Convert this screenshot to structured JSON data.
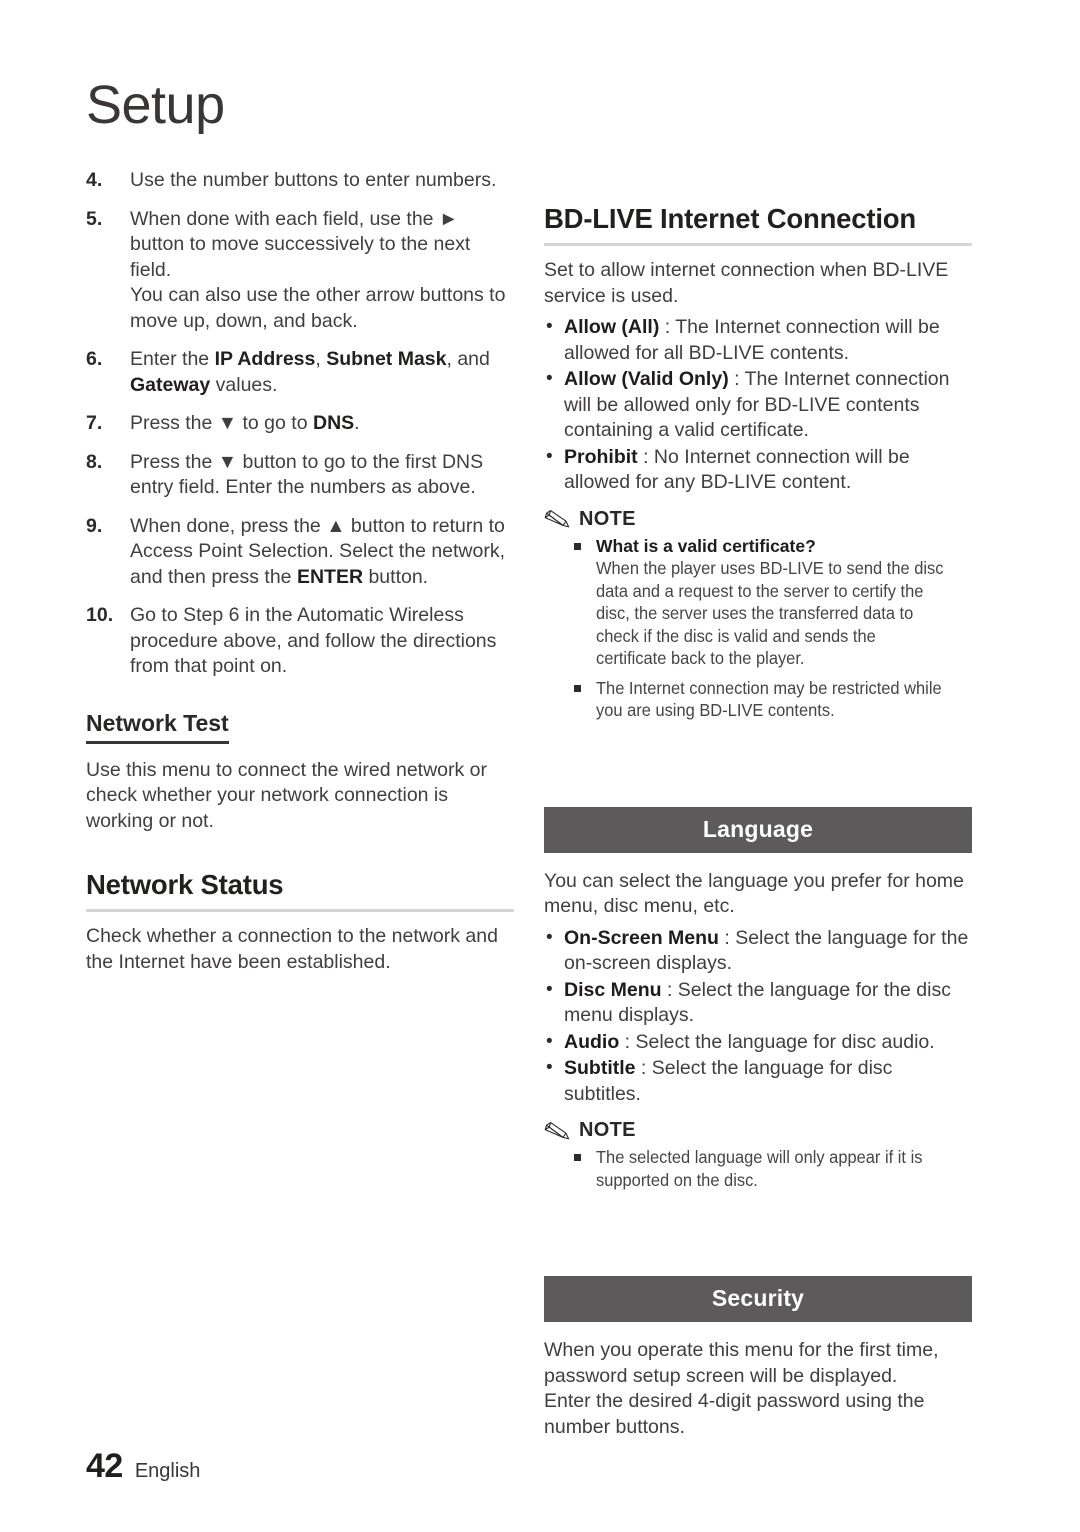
{
  "page": {
    "chapter_title": "Setup",
    "page_number": "42",
    "language": "English",
    "banner_color": "#5c5a5a",
    "text_color": "#433e3e"
  },
  "left_column": {
    "steps": [
      {
        "num": "4.",
        "html": "Use the number buttons to enter numbers."
      },
      {
        "num": "5.",
        "html": "When done with each field, use the ► button to move successively to the next field.<br>You can also use the other arrow buttons to move up, down, and back."
      },
      {
        "num": "6.",
        "html": "Enter the <b>IP Address</b>, <b>Subnet Mask</b>, and <b>Gateway</b> values."
      },
      {
        "num": "7.",
        "html": "Press the ▼ to go to <b>DNS</b>."
      },
      {
        "num": "8.",
        "html": "Press the ▼ button to go to the first DNS entry field. Enter the numbers as above."
      },
      {
        "num": "9.",
        "html": "When done, press the ▲ button to return to Access Point Selection. Select the network, and then press the <b>ENTER</b> button."
      },
      {
        "num": "10.",
        "html": "Go to Step 6 in the Automatic Wireless procedure above, and follow the directions from that point on."
      }
    ],
    "network_test": {
      "heading": "Network Test",
      "body": "Use this menu to connect the wired network or check whether your network connection is working or not."
    },
    "network_status": {
      "heading": "Network Status",
      "body": "Check whether a connection to the network and the Internet have been established."
    }
  },
  "right_column": {
    "bdlive": {
      "heading": "BD-LIVE Internet Connection",
      "body": "Set to allow internet connection when BD-LIVE service is used.",
      "options": [
        {
          "html": "<b>Allow (All)</b> : The Internet connection will be allowed for all BD-LIVE contents."
        },
        {
          "html": "<b>Allow (Valid Only)</b> : The Internet connection will be allowed only for BD-LIVE contents containing a valid certificate."
        },
        {
          "html": "<b>Prohibit</b> : No Internet connection will be allowed for any BD-LIVE content."
        }
      ],
      "note": {
        "label": "NOTE",
        "icon": "pencil-icon",
        "items": [
          {
            "title": "What is a valid certificate?",
            "text": "When the player uses BD-LIVE to send the disc data and a request to the server to certify the disc, the server uses the transferred data to check if the disc is valid and sends the certificate back to the player."
          },
          {
            "title": "",
            "text": "The Internet connection may be restricted while you are using BD-LIVE contents."
          }
        ]
      }
    },
    "language_section": {
      "banner": "Language",
      "body": "You can select the language you prefer for home menu, disc menu, etc.",
      "options": [
        {
          "html": "<b>On-Screen Menu</b> : Select the language for the on-screen displays."
        },
        {
          "html": "<b>Disc Menu</b> : Select the language for the disc menu displays."
        },
        {
          "html": "<b>Audio</b> : Select the language for disc audio."
        },
        {
          "html": "<b>Subtitle</b> : Select the language for disc subtitles."
        }
      ],
      "note": {
        "label": "NOTE",
        "icon": "pencil-icon",
        "items": [
          {
            "title": "",
            "text": "The selected language will only appear if it is supported on the disc."
          }
        ]
      }
    },
    "security_section": {
      "banner": "Security",
      "body": "When you operate this menu for the first time, password setup screen will be displayed.<br>Enter the desired 4-digit password using the number buttons."
    }
  }
}
